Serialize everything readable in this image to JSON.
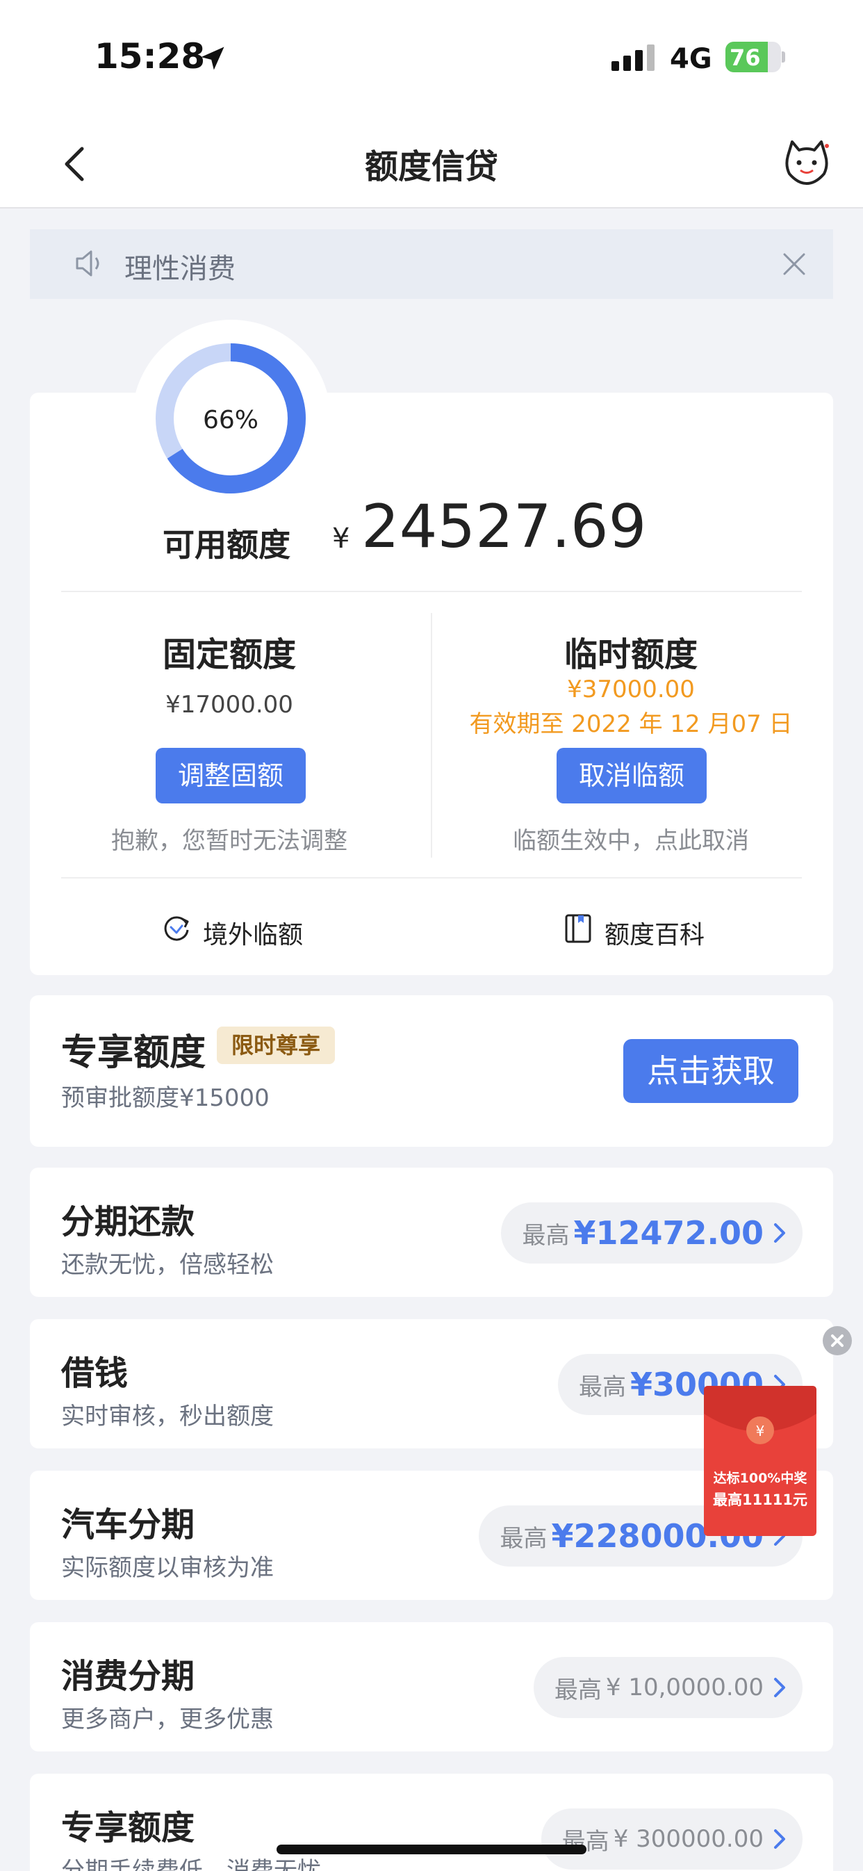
{
  "status_bar": {
    "time": "15:28",
    "network": "4G",
    "battery": "76",
    "battery_level": 0.76
  },
  "nav": {
    "title": "额度信贷"
  },
  "notice": {
    "text": "理性消费"
  },
  "quota": {
    "usage_percent": 66,
    "usage_text": "66%",
    "available_label": "可用额度",
    "currency_symbol": "¥",
    "available_amount": "24527.69",
    "fixed": {
      "title": "固定额度",
      "value": "¥17000.00",
      "button": "调整固额",
      "note": "抱歉，您暂时无法调整"
    },
    "temp": {
      "title": "临时额度",
      "value": "¥37000.00",
      "validity": "有效期至 2022 年 12 月07 日",
      "button": "取消临额",
      "note": "临额生效中，点此取消"
    },
    "links": {
      "overseas": "境外临额",
      "wiki": "额度百科"
    }
  },
  "exclusive": {
    "title": "专享额度",
    "badge": "限时尊享",
    "subtitle": "预审批额度¥15000",
    "button": "点击获取"
  },
  "rows": [
    {
      "title": "分期还款",
      "subtitle": "还款无忧，倍感轻松",
      "prefix": "最高",
      "amount": "¥12472.00"
    },
    {
      "title": "借钱",
      "subtitle": "实时审核，秒出额度",
      "prefix": "最高",
      "amount": "¥30000"
    },
    {
      "title": "汽车分期",
      "subtitle": "实际额度以审核为准",
      "prefix": "最高",
      "amount": "¥228000.00"
    },
    {
      "title": "消费分期",
      "subtitle": "更多商户，更多优惠",
      "prefix": "最高",
      "amount": "¥ 10,0000.00"
    },
    {
      "title": "专享额度",
      "subtitle": "分期手续费低，消费无忧",
      "prefix": "最高",
      "amount": "¥ 300000.00"
    }
  ],
  "red_envelope": {
    "symbol": "¥",
    "line1": "达标100%中奖",
    "line2": "最高11111元"
  },
  "colors": {
    "accent": "#4b7bec",
    "orange": "#f29a20",
    "red": "#e8413a",
    "background": "#f2f3f7"
  }
}
